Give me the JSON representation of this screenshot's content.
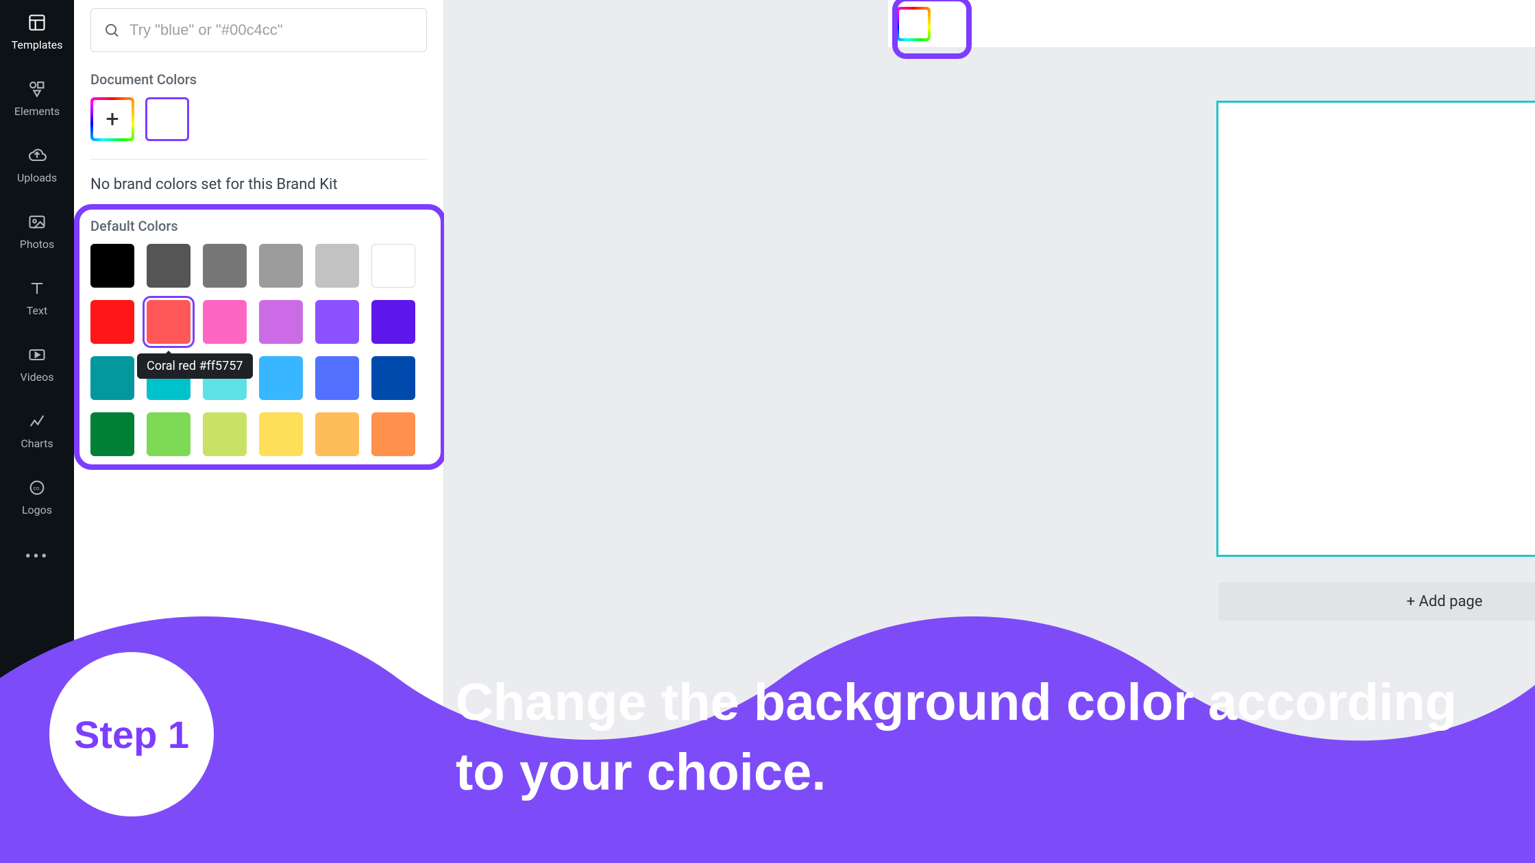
{
  "rail": {
    "items": [
      {
        "key": "templates",
        "label": "Templates"
      },
      {
        "key": "elements",
        "label": "Elements"
      },
      {
        "key": "uploads",
        "label": "Uploads"
      },
      {
        "key": "photos",
        "label": "Photos"
      },
      {
        "key": "text",
        "label": "Text"
      },
      {
        "key": "videos",
        "label": "Videos"
      },
      {
        "key": "charts",
        "label": "Charts"
      },
      {
        "key": "logos",
        "label": "Logos"
      }
    ]
  },
  "panel": {
    "search_placeholder": "Try \"blue\" or \"#00c4cc\"",
    "doc_colors_title": "Document Colors",
    "doc_current_color": "#ffffff",
    "brandkit_msg": "No brand colors set for this Brand Kit",
    "default_colors_title": "Default Colors",
    "tooltip_text": "Coral red #ff5757",
    "selected_color_index": 7,
    "default_colors": [
      "#000000",
      "#555555",
      "#777777",
      "#9c9c9c",
      "#c2c2c2",
      "#ffffff",
      "#ff1616",
      "#ff5757",
      "#ff66c4",
      "#cb6ce6",
      "#8c52ff",
      "#5e17eb",
      "#03989e",
      "#00c2cb",
      "#5ce1e6",
      "#38b6ff",
      "#5271ff",
      "#004aad",
      "#008037",
      "#7ed957",
      "#c9e265",
      "#ffde59",
      "#ffbd59",
      "#ff914d"
    ]
  },
  "canvas": {
    "add_page_label": "+ Add page"
  },
  "instruction": {
    "step_label": "Step 1",
    "text": "Change the background color according to your choice."
  }
}
